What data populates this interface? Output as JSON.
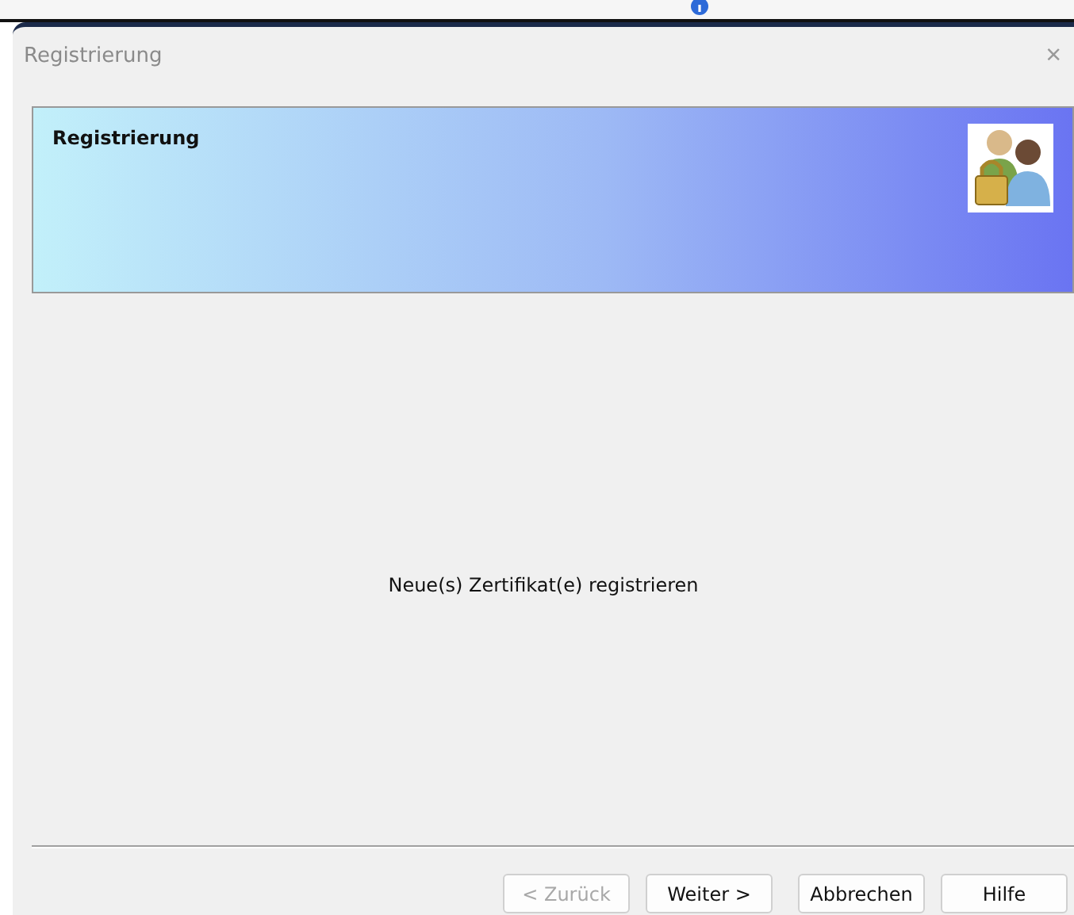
{
  "window": {
    "title": "Registrierung",
    "close": "×"
  },
  "banner": {
    "title": "Registrierung"
  },
  "message": "Neue(s) Zertifikat(e) registrieren",
  "buttons": [
    {
      "label": "< Zurück",
      "disabled": true
    },
    {
      "label": "Weiter >",
      "disabled": false
    },
    {
      "label": "Abbrechen",
      "disabled": false
    },
    {
      "label": "Hilfe",
      "disabled": false
    }
  ]
}
